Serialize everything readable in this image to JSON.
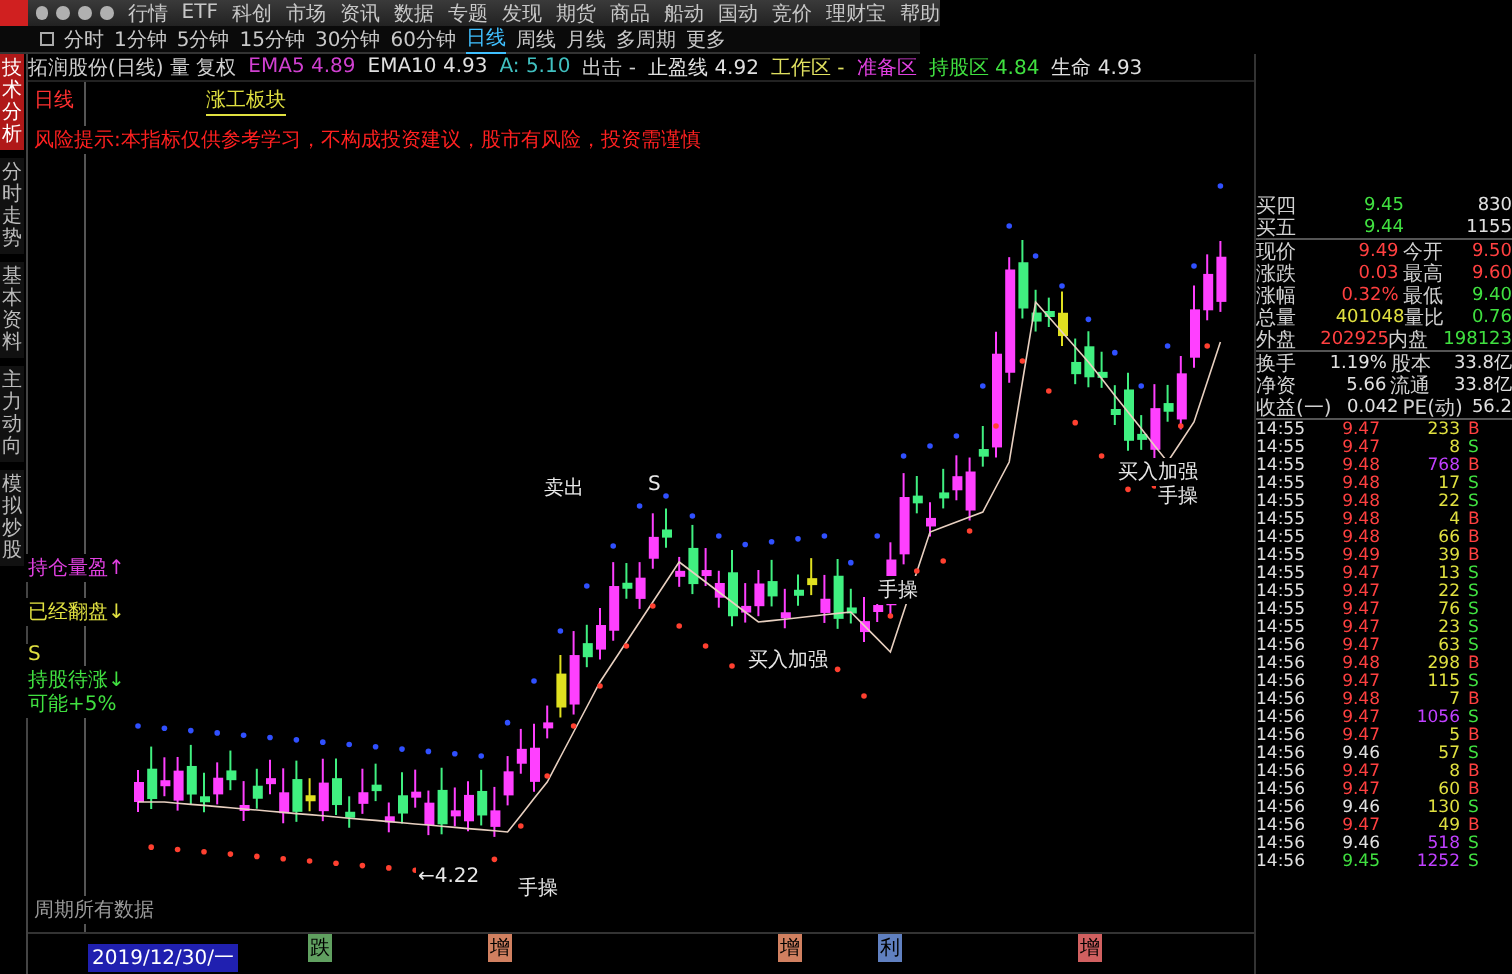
{
  "menu": {
    "items": [
      "行情",
      "ETF",
      "科创",
      "市场",
      "资讯",
      "数据",
      "专题",
      "发现",
      "期货",
      "商品",
      "船动",
      "国动",
      "竞价",
      "理财宝",
      "帮助"
    ]
  },
  "periods": [
    {
      "label": "分时",
      "selected": false
    },
    {
      "label": "1分钟",
      "selected": false
    },
    {
      "label": "5分钟",
      "selected": false
    },
    {
      "label": "15分钟",
      "selected": false
    },
    {
      "label": "30分钟",
      "selected": false
    },
    {
      "label": "60分钟",
      "selected": false
    },
    {
      "label": "日线",
      "selected": true
    },
    {
      "label": "周线",
      "selected": false
    },
    {
      "label": "月线",
      "selected": false
    },
    {
      "label": "多周期",
      "selected": false
    },
    {
      "label": "更多",
      "selected": false
    }
  ],
  "indicator_bar": [
    {
      "text": "拓润股份(日线) 量 复权",
      "color": "#d0d0d0"
    },
    {
      "text": "EMA5 4.89",
      "color": "#d040d0"
    },
    {
      "text": "EMA10 4.93",
      "color": "#e0e0e0"
    },
    {
      "text": "A: 5.10",
      "color": "#40c0c0"
    },
    {
      "text": "出击 -",
      "color": "#d0d0d0"
    },
    {
      "text": "止盈线 4.92",
      "color": "#e0e0e0"
    },
    {
      "text": "工作区 -",
      "color": "#e0e060"
    },
    {
      "text": "准备区",
      "color": "#e040e0"
    },
    {
      "text": "持股区 4.84",
      "color": "#40e040"
    },
    {
      "text": "生命 4.93",
      "color": "#e0e0e0"
    }
  ],
  "side_tabs": [
    {
      "label": "技术分析",
      "selected": true
    },
    {
      "label": "分时走势",
      "selected": false
    },
    {
      "label": "基本资料",
      "selected": false
    },
    {
      "label": "主力动向",
      "selected": false
    },
    {
      "label": "模拟炒股",
      "selected": false
    }
  ],
  "chart": {
    "title": "涨工板块",
    "corner": "日线",
    "notice": "风险提示:本指标仅供参考学习，不构成投资建议，股市有风险，投资需谨慎",
    "left_labels": [
      {
        "text": "持仓量盈↑",
        "color": "#e040e0"
      },
      {
        "text": "已经翻盘↓",
        "color": "#e0e040"
      },
      {
        "text": "S",
        "color": "#e0e040"
      },
      {
        "text": "持股待涨↓",
        "color": "#40e040"
      },
      {
        "text": "可能+5%",
        "color": "#40e040"
      }
    ],
    "marks": [
      "←4.22",
      "手操",
      "卖出",
      "S",
      "买入加强",
      "手操",
      "买入加强",
      "手操"
    ],
    "footer": "周期所有数据",
    "date": "2019/12/30/一",
    "axis_tags": [
      {
        "text": "跌",
        "color": "#60a060"
      },
      {
        "text": "增",
        "color": "#d08060"
      },
      {
        "text": "增",
        "color": "#d08060"
      },
      {
        "text": "利",
        "color": "#6080c0"
      },
      {
        "text": "增",
        "color": "#d06060"
      }
    ]
  },
  "quote": [
    {
      "cells": [
        {
          "label": "买四",
          "value": "9.45",
          "color": "#40e040"
        },
        {
          "value": "830",
          "color": "#e0e0e0"
        }
      ]
    },
    {
      "cells": [
        {
          "label": "买五",
          "value": "9.44",
          "color": "#40e040"
        },
        {
          "value": "1155",
          "color": "#e0e0e0"
        }
      ]
    },
    {
      "cells": [
        {
          "label": "现价",
          "value": "9.49",
          "color": "#ff4040"
        },
        {
          "label": "今开",
          "value": "9.50",
          "color": "#ff4040"
        }
      ]
    },
    {
      "cells": [
        {
          "label": "涨跌",
          "value": "0.03",
          "color": "#ff4040"
        },
        {
          "label": "最高",
          "value": "9.60",
          "color": "#ff4040"
        }
      ]
    },
    {
      "cells": [
        {
          "label": "涨幅",
          "value": "0.32%",
          "color": "#ff4040"
        },
        {
          "label": "最低",
          "value": "9.40",
          "color": "#40e040"
        }
      ]
    },
    {
      "cells": [
        {
          "label": "总量",
          "value": "401048",
          "color": "#e0e040"
        },
        {
          "label": "量比",
          "value": "0.76",
          "color": "#40e040"
        }
      ]
    },
    {
      "cells": [
        {
          "label": "外盘",
          "value": "202925",
          "color": "#ff4040"
        },
        {
          "label": "内盘",
          "value": "198123",
          "color": "#40e040"
        }
      ]
    },
    {
      "cells": [
        {
          "label": "换手",
          "value": "1.19%",
          "color": "#e0e0e0"
        },
        {
          "label": "股本",
          "value": "33.8亿",
          "color": "#e0e0e0"
        }
      ]
    },
    {
      "cells": [
        {
          "label": "净资",
          "value": "5.66",
          "color": "#e0e0e0"
        },
        {
          "label": "流通",
          "value": "33.8亿",
          "color": "#e0e0e0"
        }
      ]
    },
    {
      "cells": [
        {
          "label": "收益(一)",
          "value": "0.042",
          "color": "#e0e0e0"
        },
        {
          "label": "PE(动)",
          "value": "56.2",
          "color": "#e0e0e0"
        }
      ]
    }
  ],
  "ticks": [
    {
      "time": "14:55",
      "price": {
        "text": "9.47",
        "color": "#ff4040"
      },
      "vol": {
        "text": "233",
        "color": "#e0e040"
      },
      "side": {
        "text": "B",
        "color": "#ff4040"
      }
    },
    {
      "time": "14:55",
      "price": {
        "text": "9.47",
        "color": "#ff4040"
      },
      "vol": {
        "text": "8",
        "color": "#e0e040"
      },
      "side": {
        "text": "S",
        "color": "#40e040"
      }
    },
    {
      "time": "14:55",
      "price": {
        "text": "9.48",
        "color": "#ff4040"
      },
      "vol": {
        "text": "768",
        "color": "#c040ff"
      },
      "side": {
        "text": "B",
        "color": "#ff4040"
      }
    },
    {
      "time": "14:55",
      "price": {
        "text": "9.48",
        "color": "#ff4040"
      },
      "vol": {
        "text": "17",
        "color": "#e0e040"
      },
      "side": {
        "text": "S",
        "color": "#40e040"
      }
    },
    {
      "time": "14:55",
      "price": {
        "text": "9.48",
        "color": "#ff4040"
      },
      "vol": {
        "text": "22",
        "color": "#e0e040"
      },
      "side": {
        "text": "S",
        "color": "#40e040"
      }
    },
    {
      "time": "14:55",
      "price": {
        "text": "9.48",
        "color": "#ff4040"
      },
      "vol": {
        "text": "4",
        "color": "#e0e040"
      },
      "side": {
        "text": "B",
        "color": "#ff4040"
      }
    },
    {
      "time": "14:55",
      "price": {
        "text": "9.48",
        "color": "#ff4040"
      },
      "vol": {
        "text": "66",
        "color": "#e0e040"
      },
      "side": {
        "text": "B",
        "color": "#ff4040"
      }
    },
    {
      "time": "14:55",
      "price": {
        "text": "9.49",
        "color": "#ff4040"
      },
      "vol": {
        "text": "39",
        "color": "#e0e040"
      },
      "side": {
        "text": "B",
        "color": "#ff4040"
      }
    },
    {
      "time": "14:55",
      "price": {
        "text": "9.47",
        "color": "#ff4040"
      },
      "vol": {
        "text": "13",
        "color": "#e0e040"
      },
      "side": {
        "text": "S",
        "color": "#40e040"
      }
    },
    {
      "time": "14:55",
      "price": {
        "text": "9.47",
        "color": "#ff4040"
      },
      "vol": {
        "text": "22",
        "color": "#e0e040"
      },
      "side": {
        "text": "S",
        "color": "#40e040"
      }
    },
    {
      "time": "14:55",
      "price": {
        "text": "9.47",
        "color": "#ff4040"
      },
      "vol": {
        "text": "76",
        "color": "#e0e040"
      },
      "side": {
        "text": "S",
        "color": "#40e040"
      }
    },
    {
      "time": "14:55",
      "price": {
        "text": "9.47",
        "color": "#ff4040"
      },
      "vol": {
        "text": "23",
        "color": "#e0e040"
      },
      "side": {
        "text": "S",
        "color": "#40e040"
      }
    },
    {
      "time": "14:56",
      "price": {
        "text": "9.47",
        "color": "#ff4040"
      },
      "vol": {
        "text": "63",
        "color": "#e0e040"
      },
      "side": {
        "text": "S",
        "color": "#40e040"
      }
    },
    {
      "time": "14:56",
      "price": {
        "text": "9.48",
        "color": "#ff4040"
      },
      "vol": {
        "text": "298",
        "color": "#e0e040"
      },
      "side": {
        "text": "B",
        "color": "#ff4040"
      }
    },
    {
      "time": "14:56",
      "price": {
        "text": "9.47",
        "color": "#ff4040"
      },
      "vol": {
        "text": "115",
        "color": "#e0e040"
      },
      "side": {
        "text": "S",
        "color": "#40e040"
      }
    },
    {
      "time": "14:56",
      "price": {
        "text": "9.48",
        "color": "#ff4040"
      },
      "vol": {
        "text": "7",
        "color": "#e0e040"
      },
      "side": {
        "text": "B",
        "color": "#ff4040"
      }
    },
    {
      "time": "14:56",
      "price": {
        "text": "9.47",
        "color": "#ff4040"
      },
      "vol": {
        "text": "1056",
        "color": "#c040ff"
      },
      "side": {
        "text": "S",
        "color": "#40e040"
      }
    },
    {
      "time": "14:56",
      "price": {
        "text": "9.47",
        "color": "#ff4040"
      },
      "vol": {
        "text": "5",
        "color": "#e0e040"
      },
      "side": {
        "text": "B",
        "color": "#ff4040"
      }
    },
    {
      "time": "14:56",
      "price": {
        "text": "9.46",
        "color": "#e0e0e0"
      },
      "vol": {
        "text": "57",
        "color": "#e0e040"
      },
      "side": {
        "text": "S",
        "color": "#40e040"
      }
    },
    {
      "time": "14:56",
      "price": {
        "text": "9.47",
        "color": "#ff4040"
      },
      "vol": {
        "text": "8",
        "color": "#e0e040"
      },
      "side": {
        "text": "B",
        "color": "#ff4040"
      }
    },
    {
      "time": "14:56",
      "price": {
        "text": "9.47",
        "color": "#ff4040"
      },
      "vol": {
        "text": "60",
        "color": "#e0e040"
      },
      "side": {
        "text": "B",
        "color": "#ff4040"
      }
    },
    {
      "time": "14:56",
      "price": {
        "text": "9.46",
        "color": "#e0e0e0"
      },
      "vol": {
        "text": "130",
        "color": "#e0e040"
      },
      "side": {
        "text": "S",
        "color": "#40e040"
      }
    },
    {
      "time": "14:56",
      "price": {
        "text": "9.47",
        "color": "#ff4040"
      },
      "vol": {
        "text": "49",
        "color": "#e0e040"
      },
      "side": {
        "text": "B",
        "color": "#ff4040"
      }
    },
    {
      "time": "14:56",
      "price": {
        "text": "9.46",
        "color": "#e0e0e0"
      },
      "vol": {
        "text": "518",
        "color": "#c040ff"
      },
      "side": {
        "text": "S",
        "color": "#40e040"
      }
    },
    {
      "time": "14:56",
      "price": {
        "text": "9.45",
        "color": "#40e040"
      },
      "vol": {
        "text": "1252",
        "color": "#c040ff"
      },
      "side": {
        "text": "S",
        "color": "#40e040"
      }
    }
  ]
}
